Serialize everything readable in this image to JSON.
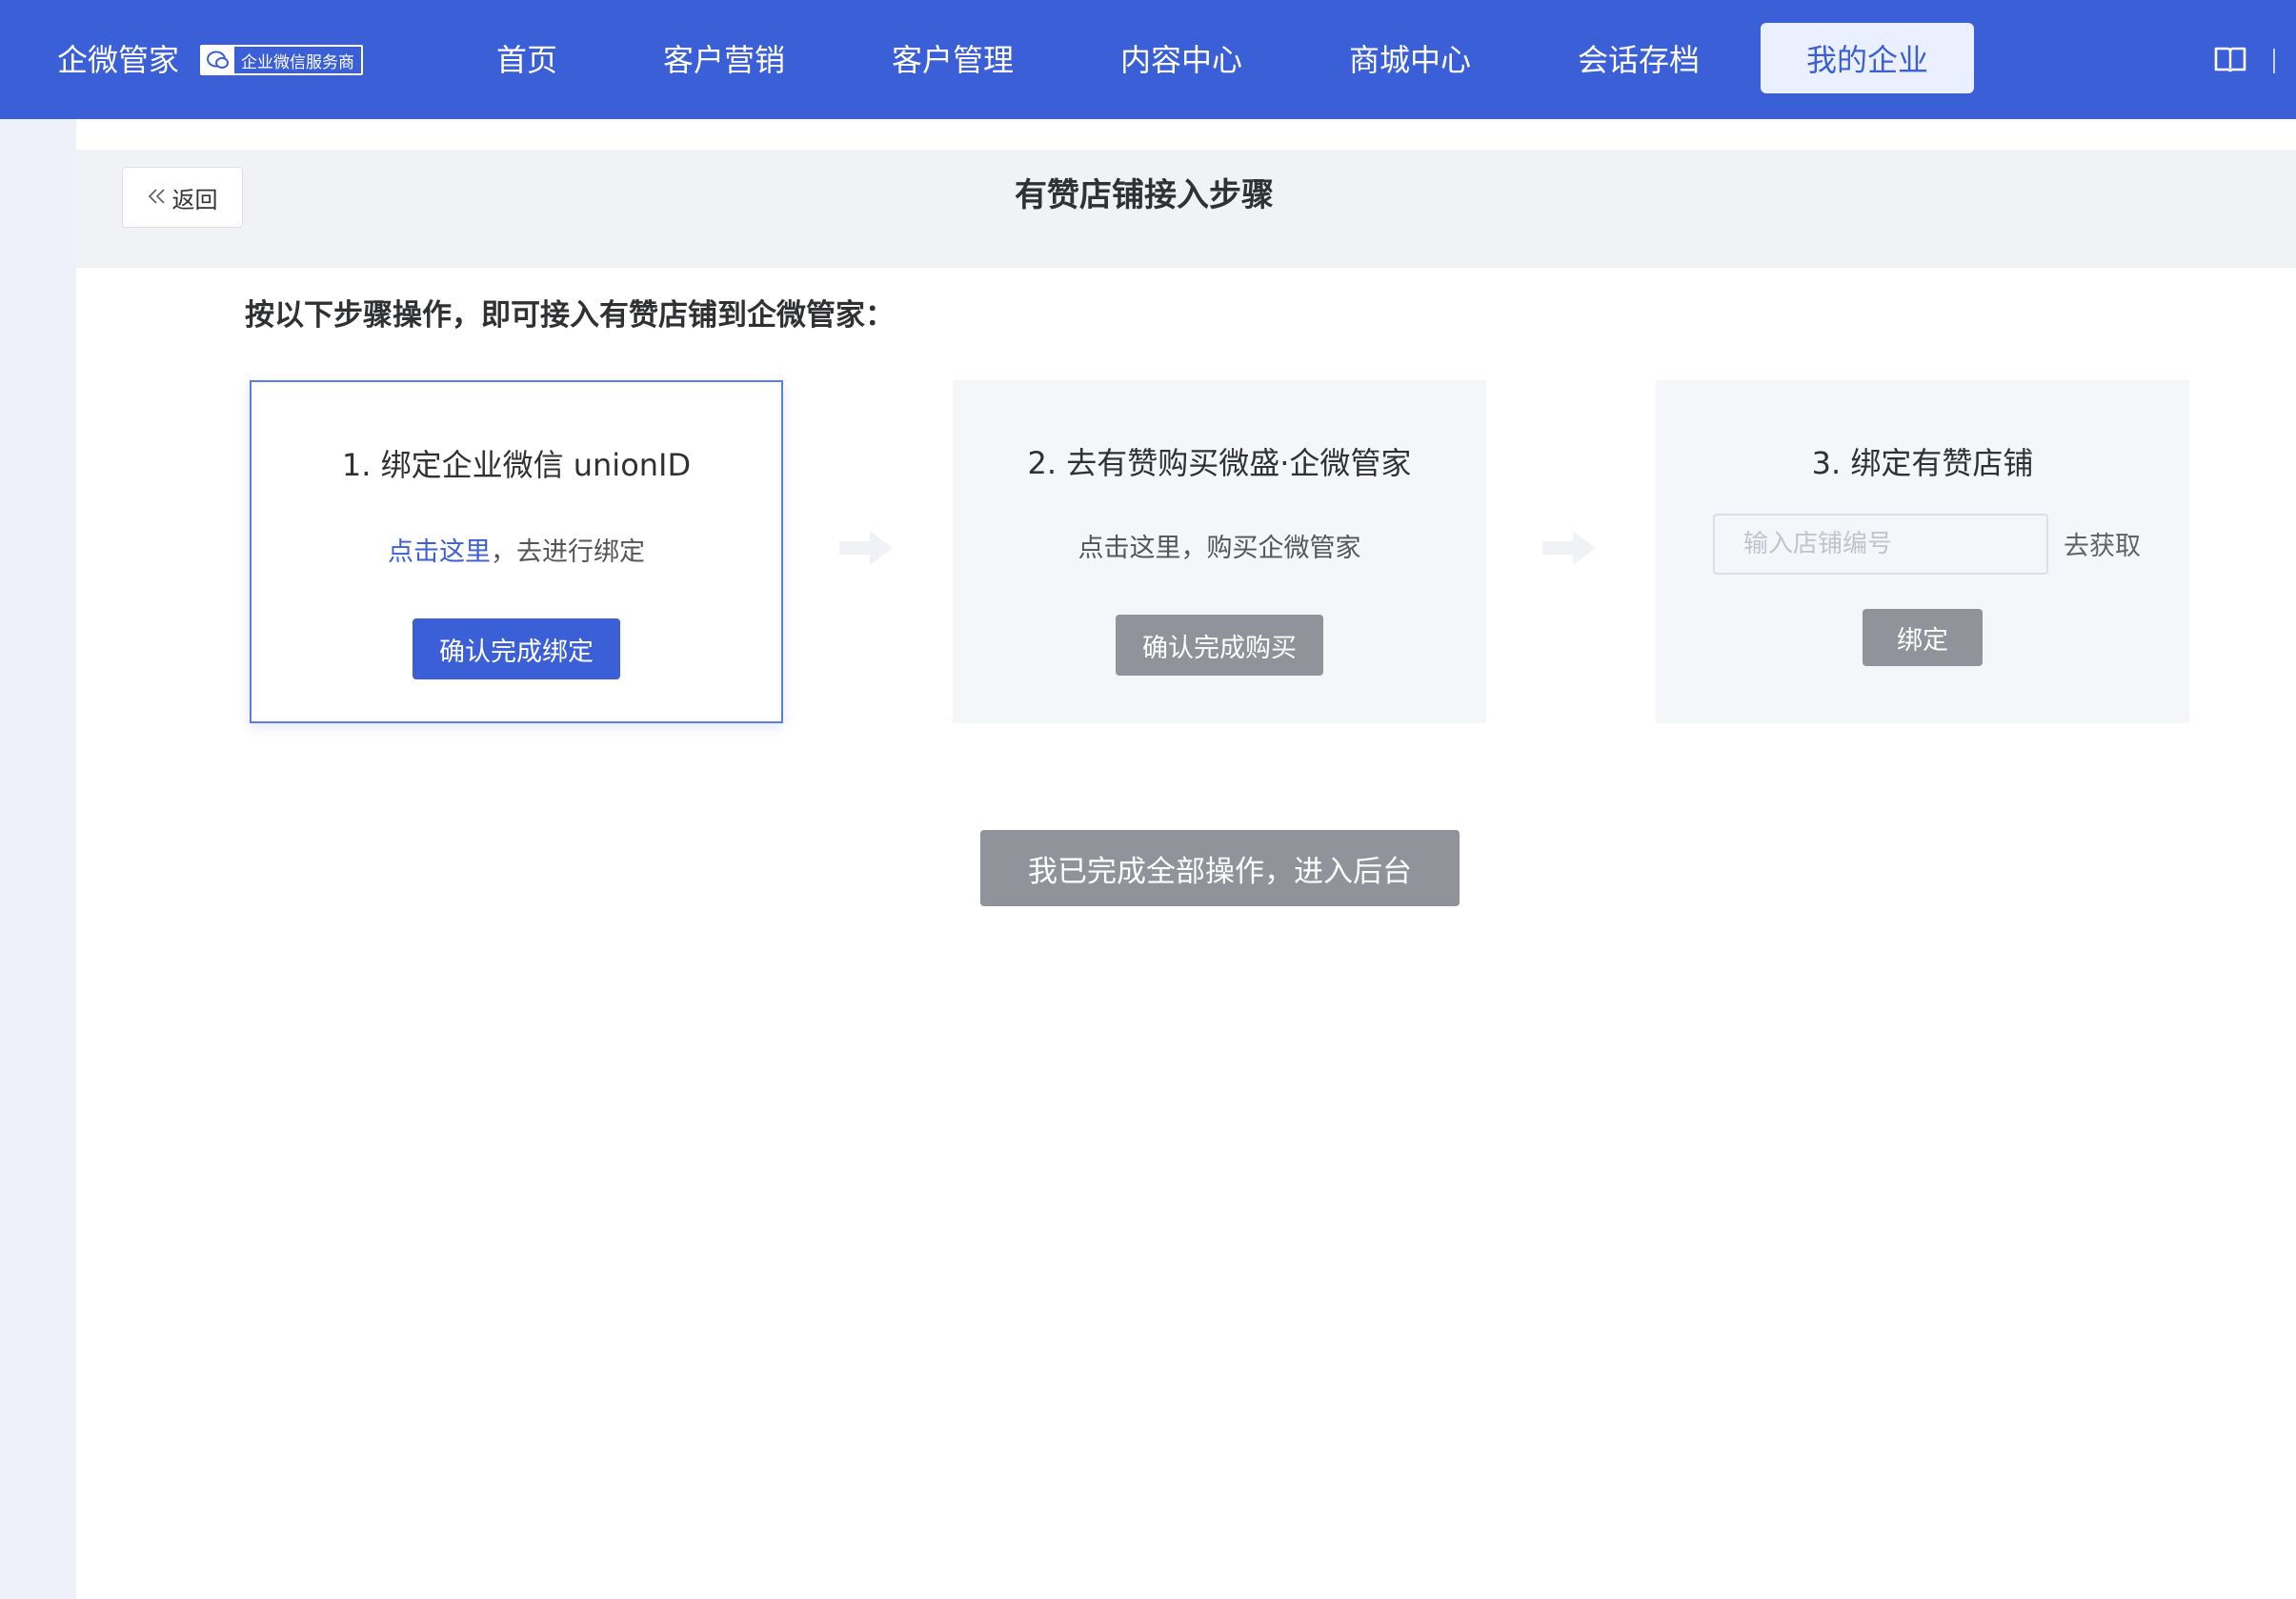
{
  "header": {
    "brand": "企微管家",
    "badge_text": "企业微信服务商",
    "nav": [
      {
        "label": "首页"
      },
      {
        "label": "客户营销"
      },
      {
        "label": "客户管理"
      },
      {
        "label": "内容中心"
      },
      {
        "label": "商城中心"
      },
      {
        "label": "会话存档"
      },
      {
        "label": "我的企业",
        "active": true
      }
    ],
    "icons": [
      "chat-bubble-icon",
      "book-icon"
    ]
  },
  "page": {
    "back_label": "返回",
    "title": "有赞店铺接入步骤",
    "intro": "按以下步骤操作，即可接入有赞店铺到企微管家："
  },
  "steps": [
    {
      "title": "1. 绑定企业微信 unionID",
      "link": "点击这里",
      "desc_rest": "，去进行绑定",
      "button": "确认完成绑定",
      "state": "active"
    },
    {
      "title": "2. 去有赞购买微盛·企微管家",
      "desc": "点击这里，购买企微管家",
      "button": "确认完成购买",
      "state": "disabled"
    },
    {
      "title": "3. 绑定有赞店铺",
      "input_placeholder": "输入店铺编号",
      "input_value": "",
      "fetch_label": "去获取",
      "button": "绑定",
      "state": "disabled"
    }
  ],
  "finish_button": "我已完成全部操作，进入后台",
  "colors": {
    "primary": "#3b5fd6",
    "disabled_button": "#909399",
    "card_bg": "#f5f6fa",
    "page_bg": "#eef1fa"
  }
}
